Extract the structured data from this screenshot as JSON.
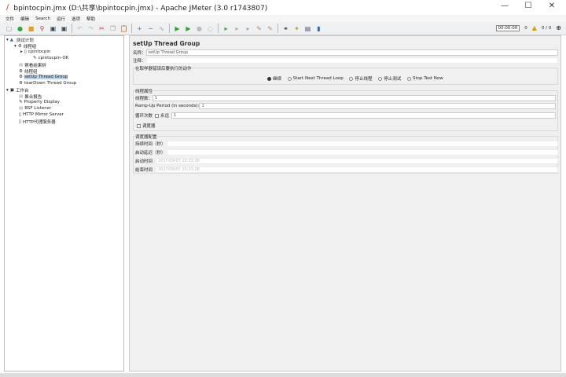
{
  "window": {
    "title": "bpintocpin.jmx (D:\\共享\\bpintocpin.jmx) - Apache JMeter (3.0 r1743807)",
    "minimize": "—",
    "maximize": "☐",
    "close": "✕"
  },
  "menu": [
    "文件",
    "编辑",
    "Search",
    "运行",
    "选项",
    "帮助"
  ],
  "status": {
    "timer": "00:00:00",
    "warnings": "0",
    "threads": "0 / 0"
  },
  "tree": [
    {
      "label": "测试计划",
      "icon": "test-plan-icon"
    },
    {
      "label": "线程组",
      "icon": "gear-icon"
    },
    {
      "label": "cpintocpin",
      "icon": "sampler-icon"
    },
    {
      "label": "cpintocpin-OK",
      "icon": "pencil-icon"
    },
    {
      "label": "察看结果树",
      "icon": "listener-icon"
    },
    {
      "label": "线程组",
      "icon": "gear-icon"
    },
    {
      "label": "setUp Thread Group",
      "icon": "gear-icon"
    },
    {
      "label": "tearDown Thread Group",
      "icon": "gear-icon"
    },
    {
      "label": "工作台",
      "icon": "workbench-icon"
    },
    {
      "label": "聚合报告",
      "icon": "listener-icon"
    },
    {
      "label": "Property Display",
      "icon": "pencil-icon"
    },
    {
      "label": "BSF Listener",
      "icon": "listener-icon"
    },
    {
      "label": "HTTP Mirror Server",
      "icon": "server-icon"
    },
    {
      "label": "HTTP代理服务器",
      "icon": "server-icon"
    }
  ],
  "panel": {
    "title": "setUp Thread Group",
    "name_label": "名称：",
    "name_value": "setUp Thread Group",
    "comment_label": "注释：",
    "error_group": "在取样器错误后要执行的动作",
    "error_options": [
      "继续",
      "Start Next Thread Loop",
      "停止线程",
      "停止测试",
      "Stop Test Now"
    ],
    "thread_group": "线程属性",
    "threads_label": "线程数：",
    "threads_value": "1",
    "rampup_label": "Ramp-Up Period (in seconds):",
    "rampup_value": "1",
    "loop_label": "循环次数",
    "forever_label": "永远",
    "loop_value": "1",
    "scheduler_label": "调度器",
    "sched_group": "调度器配置",
    "duration_label": "持续时间（秒）",
    "delay_label": "启动延迟（秒）",
    "start_label": "启动时间",
    "start_value": "2017/09/07 15:33:28",
    "end_label": "结束时间",
    "end_value": "2017/09/07 15:33:28"
  }
}
